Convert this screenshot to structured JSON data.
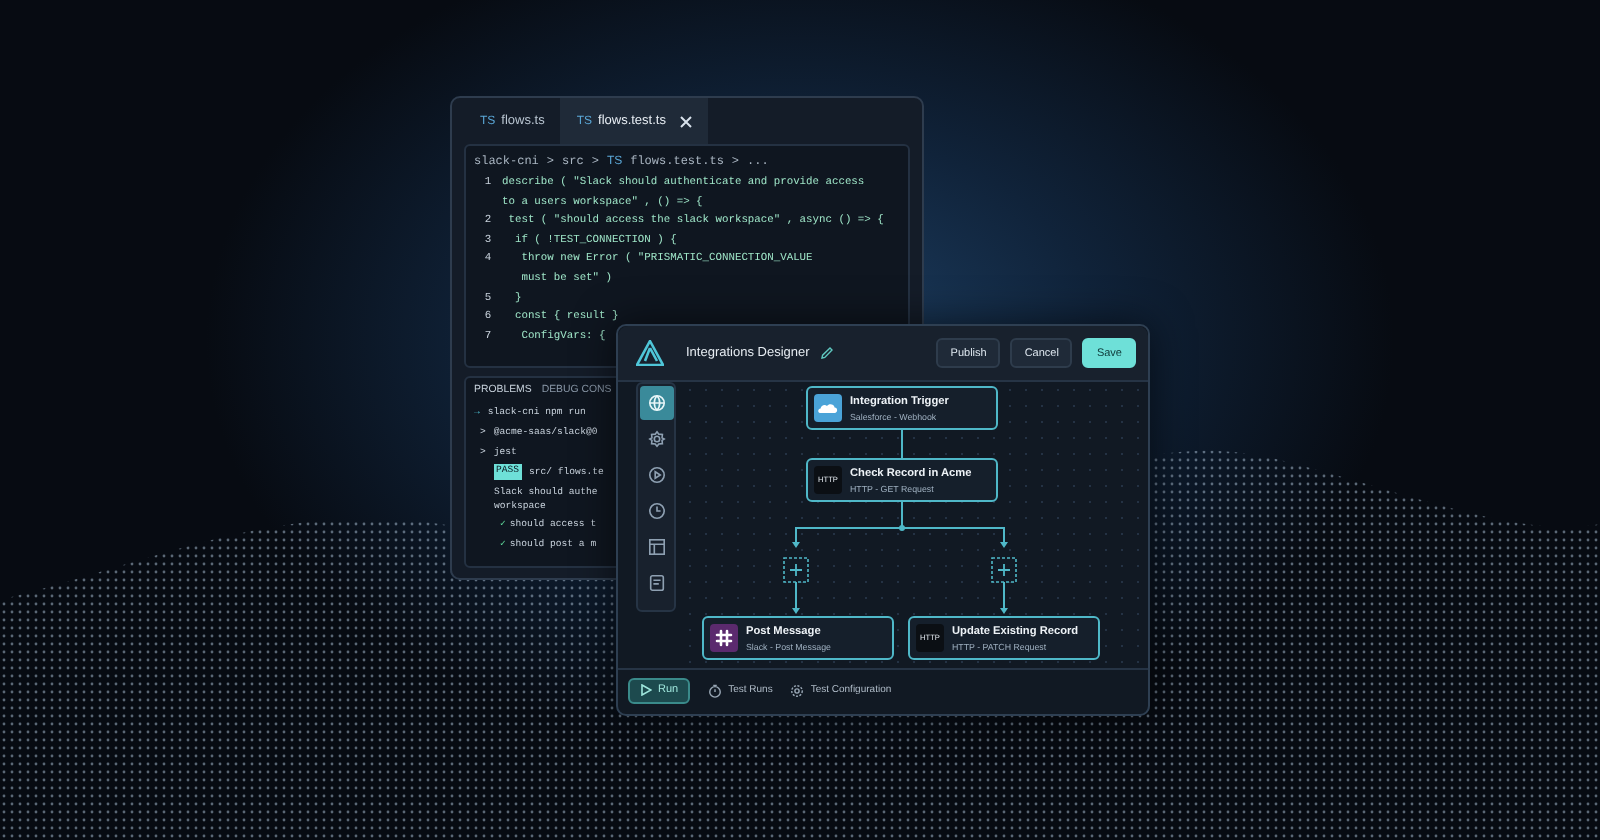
{
  "code_window": {
    "tabs": [
      {
        "badge": "TS",
        "label": "flows.ts",
        "selected": false,
        "closable": false
      },
      {
        "badge": "TS",
        "label": "flows.test.ts",
        "selected": true,
        "closable": true
      }
    ],
    "breadcrumb": [
      {
        "label": "slack-cni"
      },
      {
        "label": "src"
      },
      {
        "badge": "TS",
        "label": "flows.test.ts"
      },
      {
        "label": "..."
      }
    ],
    "breadcrumb_separator": ">",
    "code_lines": [
      {
        "number": "1",
        "text": "describe ( \"Slack should authenticate and provide access\nto a users workspace\" , () => {"
      },
      {
        "number": "2",
        "text": " test ( \"should access the slack workspace\" , async () => {"
      },
      {
        "number": "3",
        "text": "  if ( !TEST_CONNECTION ) {"
      },
      {
        "number": "4",
        "text": "   throw new Error ( \"PRISMATIC_CONNECTION_VALUE\n   must be set\" )"
      },
      {
        "number": "5",
        "text": "  }"
      },
      {
        "number": "6",
        "text": "  const { result }"
      },
      {
        "number": "7",
        "text": "   ConfigVars: {"
      }
    ],
    "terminal_tabs": [
      {
        "label": "PROBLEMS",
        "selected": true
      },
      {
        "label": "DEBUG CONS",
        "selected": false
      }
    ],
    "terminal_lines": [
      {
        "kind": "prompt",
        "marker": "→",
        "text": "slack-cni npm run"
      },
      {
        "kind": "output",
        "marker": ">",
        "text": "@acme-saas/slack@0"
      },
      {
        "kind": "output",
        "marker": ">",
        "text": "jest"
      },
      {
        "kind": "pass",
        "badge": "PASS",
        "text": "src/ flows.te"
      },
      {
        "kind": "plain",
        "text": "Slack should authe\nworkspace"
      },
      {
        "kind": "check",
        "marker": "✓",
        "text": "should access t"
      },
      {
        "kind": "check",
        "marker": "✓",
        "text": "should post a m"
      }
    ]
  },
  "designer": {
    "title": "Integrations Designer",
    "buttons": [
      {
        "label": "Publish",
        "kind": "secondary"
      },
      {
        "label": "Cancel",
        "kind": "secondary"
      },
      {
        "label": "Save",
        "kind": "primary"
      }
    ],
    "sidebar_items": [
      {
        "selected": true
      },
      {
        "selected": false
      },
      {
        "selected": false
      },
      {
        "selected": false
      },
      {
        "selected": false
      },
      {
        "selected": false
      }
    ],
    "nodes": [
      {
        "kind": "salesforce",
        "title": "Integration Trigger",
        "subtitle": "Salesforce - Webhook"
      },
      {
        "kind": "http",
        "icon_text": "HTTP",
        "title": "Check Record in Acme",
        "subtitle": "HTTP - GET Request"
      },
      {
        "kind": "slack",
        "title": "Post Message",
        "subtitle": "Slack - Post Message"
      },
      {
        "kind": "http",
        "icon_text": "HTTP",
        "title": "Update Existing Record",
        "subtitle": "HTTP - PATCH Request"
      }
    ],
    "footer": {
      "run_label": "Run",
      "links": [
        "Test Runs",
        "Test Configuration"
      ]
    }
  }
}
